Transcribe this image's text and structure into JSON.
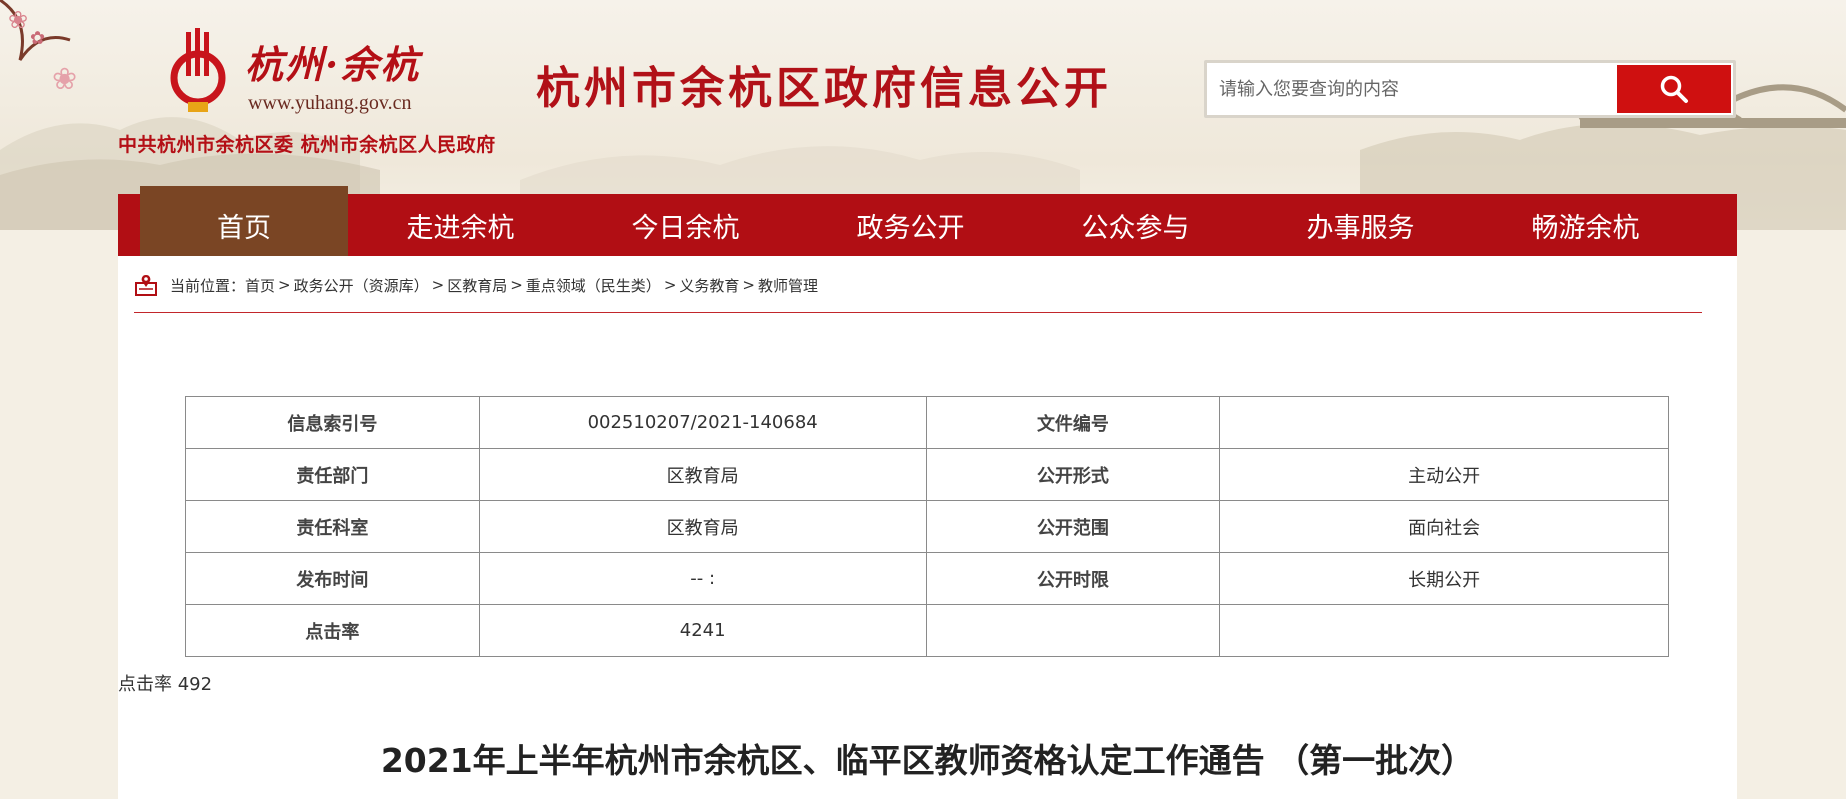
{
  "header": {
    "logo_text": "杭州·余杭",
    "logo_url": "www.yuhang.gov.cn",
    "sub_orgs": "中共杭州市余杭区委  杭州市余杭区人民政府",
    "site_title": "杭州市余杭区政府信息公开",
    "search": {
      "placeholder": "请输入您要查询的内容",
      "icon": "search-icon"
    }
  },
  "nav": {
    "items": [
      {
        "label": "首页",
        "active": true
      },
      {
        "label": "走进余杭"
      },
      {
        "label": "今日余杭"
      },
      {
        "label": "政务公开"
      },
      {
        "label": "公众参与"
      },
      {
        "label": "办事服务"
      },
      {
        "label": "畅游余杭"
      }
    ]
  },
  "breadcrumb": {
    "prefix": "当前位置：",
    "items": [
      "首页",
      "政务公开（资源库）",
      "区教育局",
      "重点领域（民生类）",
      "义务教育",
      "教师管理"
    ],
    "separator": ">"
  },
  "meta_table": {
    "rows": [
      {
        "l1": "信息索引号",
        "v1": "002510207/2021-140684",
        "l2": "文件编号",
        "v2": ""
      },
      {
        "l1": "责任部门",
        "v1": "区教育局",
        "l2": "公开形式",
        "v2": "主动公开"
      },
      {
        "l1": "责任科室",
        "v1": "区教育局",
        "l2": "公开范围",
        "v2": "面向社会"
      },
      {
        "l1": "发布时间",
        "v1": "-- :",
        "l2": "公开时限",
        "v2": "长期公开"
      },
      {
        "l1": "点击率",
        "v1": "4241",
        "l2": "",
        "v2": ""
      }
    ]
  },
  "clicks_line": "点击率 492",
  "article_title": "2021年上半年杭州市余杭区、临平区教师资格认定工作通告 （第一批次）",
  "colors": {
    "brand_red": "#b10e14",
    "nav_active": "#7a4524",
    "search_btn": "#cf1010"
  }
}
